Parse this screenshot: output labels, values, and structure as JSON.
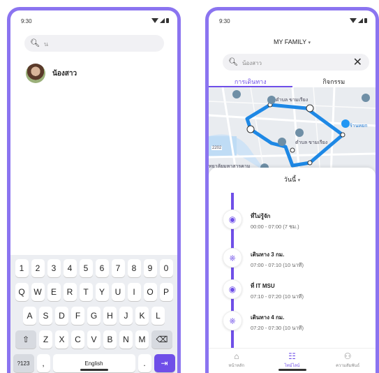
{
  "screen1": {
    "status_time": "9:30",
    "search_value": "น",
    "contact_name": "น้องสาว",
    "keyboard": {
      "row_numbers": [
        "1",
        "2",
        "3",
        "4",
        "5",
        "6",
        "7",
        "8",
        "9",
        "0"
      ],
      "row_top": [
        "Q",
        "W",
        "E",
        "R",
        "T",
        "Y",
        "U",
        "I",
        "O",
        "P"
      ],
      "row_middle": [
        "A",
        "S",
        "D",
        "F",
        "G",
        "H",
        "J",
        "K",
        "L"
      ],
      "row_bottom": [
        "Z",
        "X",
        "C",
        "V",
        "B",
        "N",
        "M"
      ],
      "symbols_key": "?123",
      "comma_key": ",",
      "space_label": "English",
      "period_key": "."
    }
  },
  "screen2": {
    "status_time": "9:30",
    "family_title": "MY FAMILY",
    "search_value": "น้องสาว",
    "tabs": [
      {
        "label": "การเดินทาง",
        "active": true
      },
      {
        "label": "กิจกรรม",
        "active": false
      }
    ],
    "map_labels": [
      "ตำบล ขามเรียง",
      "ตำบล ขามเรียง",
      "ร้านหยก",
      "ทยาลัยมหาสารคาม",
      "2202"
    ],
    "date_filter": "วันนี้",
    "timeline": [
      {
        "type": "place",
        "title": "ที่ไม่รู้จัก",
        "time": "00:00 - 07:00 (7 ชม.)"
      },
      {
        "type": "travel",
        "title": "เดินทาง 3 กม.",
        "time": "07:00 - 07:10 (10 นาที)"
      },
      {
        "type": "place",
        "title": "ที่ IT MSU",
        "time": "07:10 - 07:20 (10 นาที)"
      },
      {
        "type": "travel",
        "title": "เดินทาง 4 กม.",
        "time": "07:20 - 07:30 (10 นาที)"
      }
    ],
    "bottom_nav": [
      {
        "label": "หน้าหลัก",
        "icon": "home-icon",
        "active": false
      },
      {
        "label": "ไทม์ไลน์",
        "icon": "timeline-icon",
        "active": true
      },
      {
        "label": "ความสัมพันธ์",
        "icon": "relationship-icon",
        "active": false
      }
    ]
  },
  "colors": {
    "accent": "#6f4fe8",
    "frame": "#8b74f0",
    "route": "#1e88e5"
  }
}
